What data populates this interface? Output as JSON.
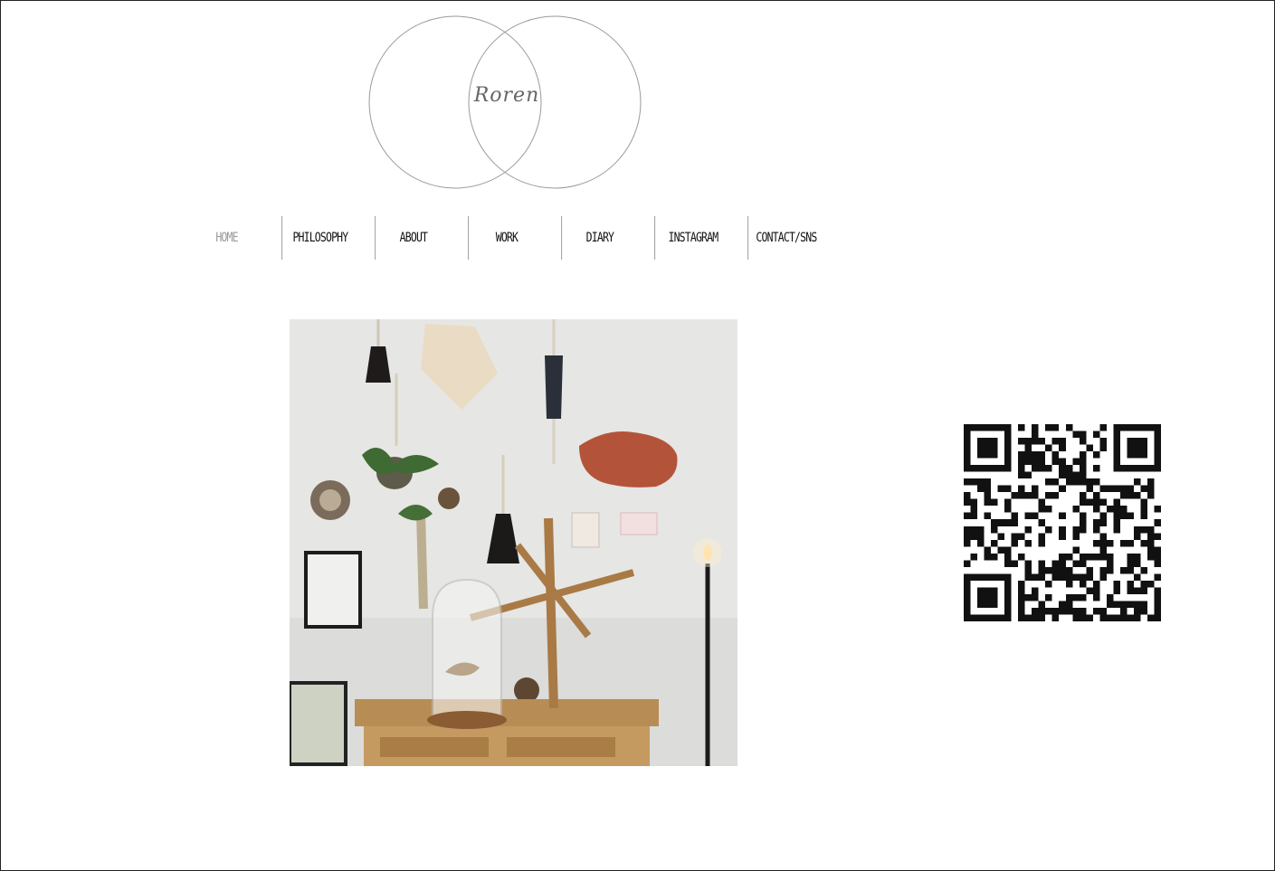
{
  "logo": {
    "text": "Roren"
  },
  "nav": [
    {
      "label": "HOME",
      "active": true
    },
    {
      "label": "PHILOSOPHY",
      "active": false
    },
    {
      "label": "ABOUT",
      "active": false
    },
    {
      "label": "WORK",
      "active": false
    },
    {
      "label": "DIARY",
      "active": false
    },
    {
      "label": "INSTAGRAM",
      "active": false
    },
    {
      "label": "CONTACT/SNS",
      "active": false
    }
  ],
  "colors": {
    "accent_active": "#999999",
    "text": "#111111",
    "divider": "#888888"
  },
  "images": {
    "main": {
      "kind": "interior photo"
    },
    "qr": {
      "kind": "qr code"
    }
  }
}
